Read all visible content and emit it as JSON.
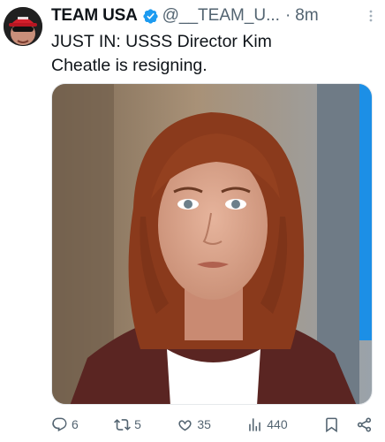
{
  "author": {
    "display_name": "TEAM USA",
    "handle": "@__TEAM_U...",
    "separator": "·",
    "time": "8m",
    "avatar_icon": "profile-avatar-red-cap"
  },
  "tweet": {
    "text_line1": "JUST IN: USSS Director Kim",
    "text_line2": "Cheatle is resigning."
  },
  "media": {
    "description_icon": "news-photo"
  },
  "actions": {
    "replies": "6",
    "reposts": "5",
    "likes": "35",
    "views": "440"
  },
  "colors": {
    "verified": "#1d9bf0",
    "secondary_text": "#536471"
  }
}
